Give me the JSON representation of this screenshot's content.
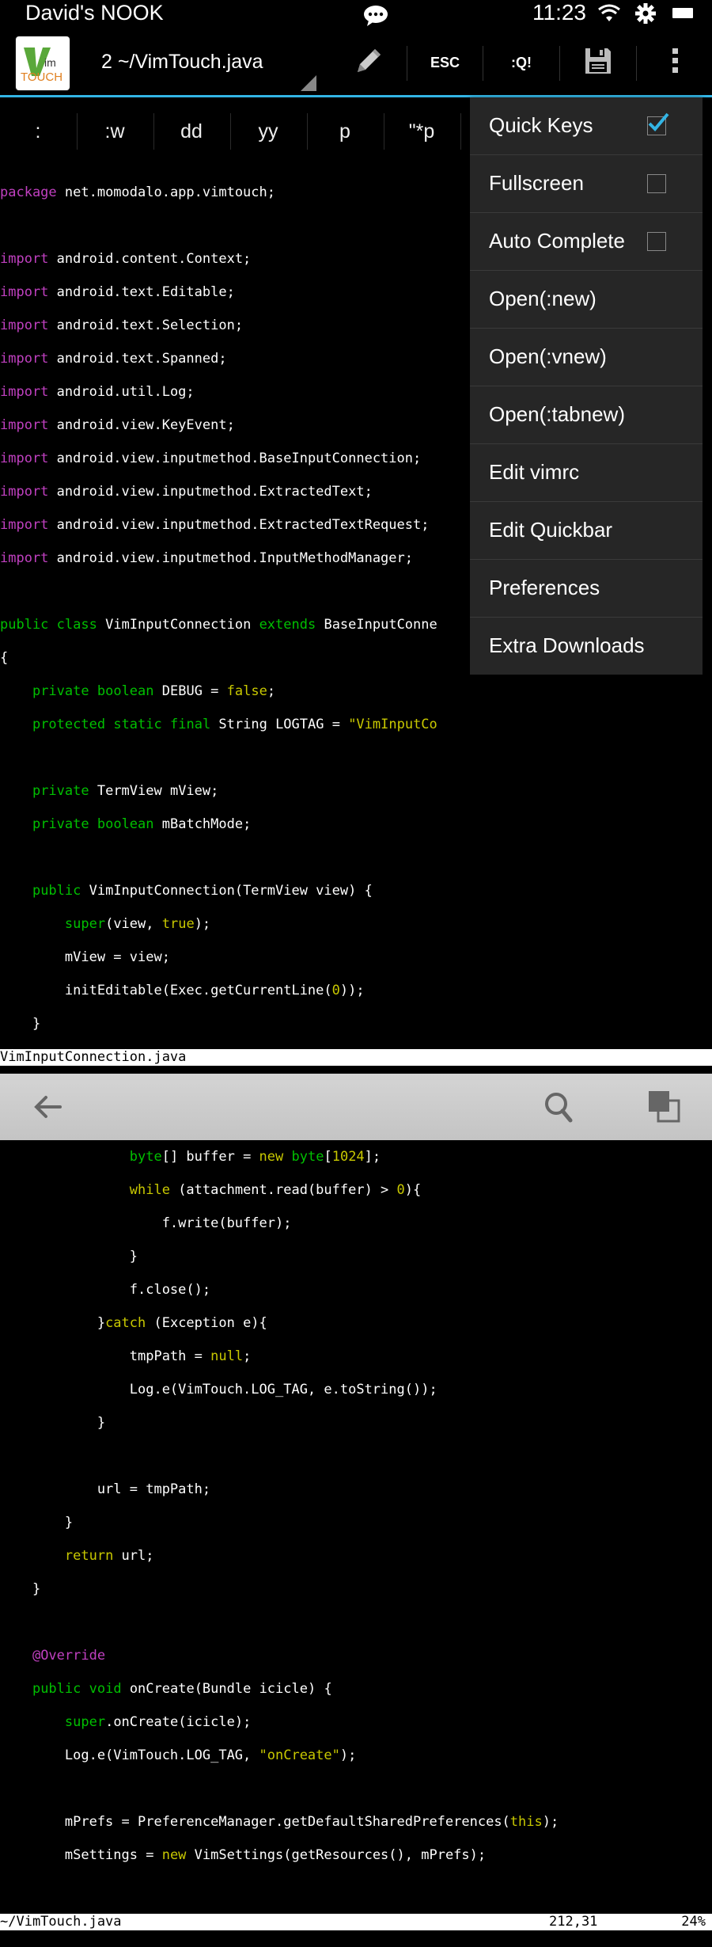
{
  "status_bar": {
    "owner": "David's NOOK",
    "time": "11:23",
    "icons": [
      "chat-icon",
      "wifi-icon",
      "settings-icon",
      "battery-icon"
    ]
  },
  "action_bar": {
    "app_icon": "vim-touch-logo",
    "title": "2 ~/VimTouch.java",
    "buttons": {
      "edit": "pencil-icon",
      "esc": "ESC",
      "quit": ":Q!",
      "save": "save-icon",
      "overflow": "overflow-icon"
    }
  },
  "quick_keys": [
    ":",
    ":w",
    "dd",
    "yy",
    "p",
    "\"*p"
  ],
  "menu": {
    "items": [
      {
        "label": "Quick Keys",
        "checkbox": true,
        "checked": true
      },
      {
        "label": "Fullscreen",
        "checkbox": true,
        "checked": false
      },
      {
        "label": "Auto Complete",
        "checkbox": true,
        "checked": false
      },
      {
        "label": "Open(:new)"
      },
      {
        "label": "Open(:vnew)"
      },
      {
        "label": "Open(:tabnew)"
      },
      {
        "label": "Edit vimrc"
      },
      {
        "label": "Edit Quickbar"
      },
      {
        "label": "Preferences"
      },
      {
        "label": "Extra Downloads"
      }
    ]
  },
  "editor": {
    "pane1_status": "VimInputConnection.java",
    "status_file": "~/VimTouch.java",
    "status_pos": "212,31",
    "status_pct": "24%"
  },
  "nav_bar": {
    "icons": [
      "back-icon",
      "search-icon",
      "recent-apps-icon"
    ]
  },
  "colors": {
    "accent": "#33b5e5",
    "keyword": "#c040c0",
    "type_keyword": "#00c000",
    "string": "#c8c800"
  }
}
